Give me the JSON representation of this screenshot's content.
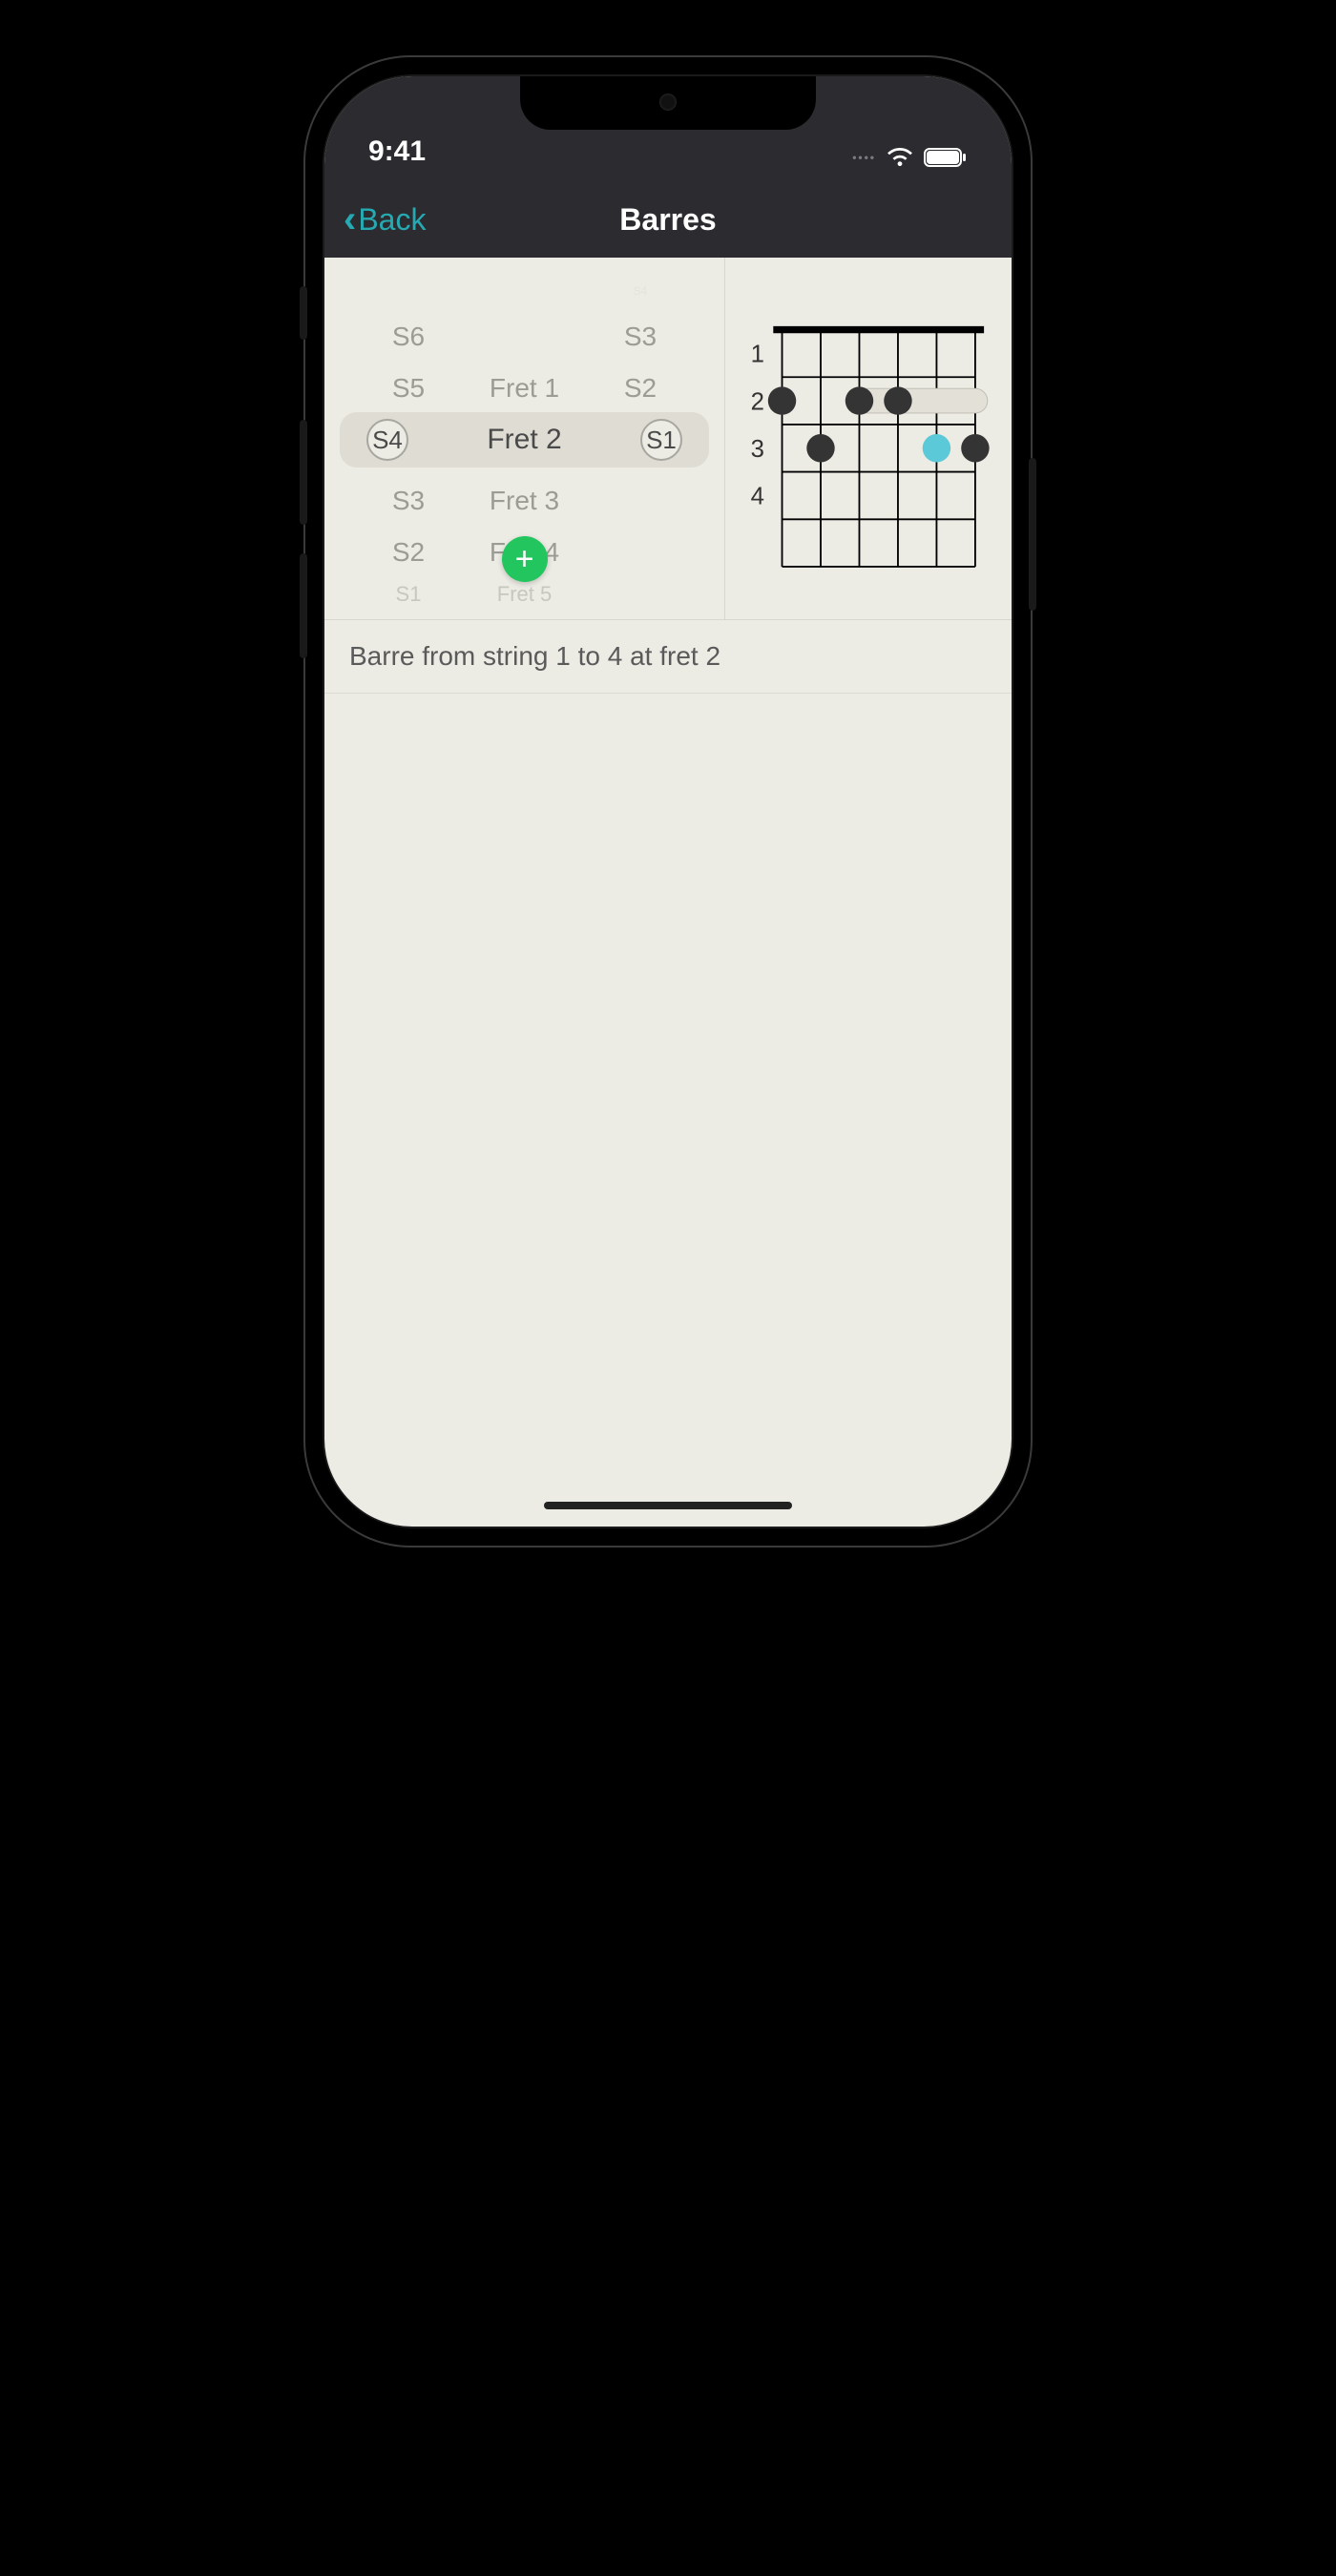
{
  "status": {
    "time": "9:41"
  },
  "nav": {
    "back": "Back",
    "title": "Barres"
  },
  "picker": {
    "left": {
      "selected": "S4",
      "above": [
        "S6",
        "S5"
      ],
      "below": [
        "S3",
        "S2",
        "S1"
      ]
    },
    "center": {
      "selected": "Fret 2",
      "above": [
        "",
        "Fret 1"
      ],
      "below": [
        "Fret 3",
        "Fret 4",
        "Fret 5"
      ]
    },
    "right": {
      "selected": "S1",
      "above_far": "S4",
      "above": [
        "S3",
        "S2"
      ],
      "below": [
        "",
        "",
        ""
      ]
    }
  },
  "diagram": {
    "fret_labels": [
      "1",
      "2",
      "3",
      "4"
    ],
    "strings": 6,
    "frets": 5,
    "barre": {
      "fret": 2,
      "from_string": 4,
      "to_string": 1
    },
    "dots": [
      {
        "string": 6,
        "fret": 2,
        "color": "#343434"
      },
      {
        "string": 4,
        "fret": 2,
        "color": "#343434"
      },
      {
        "string": 3,
        "fret": 2,
        "color": "#343434"
      },
      {
        "string": 5,
        "fret": 3,
        "color": "#343434"
      },
      {
        "string": 2,
        "fret": 3,
        "color": "#5bc9d7"
      },
      {
        "string": 1,
        "fret": 3,
        "color": "#343434"
      }
    ]
  },
  "rows": {
    "desc": "Barre from string 1 to 4 at fret 2"
  },
  "colors": {
    "accent": "#26aab2",
    "add": "#22c55e"
  }
}
